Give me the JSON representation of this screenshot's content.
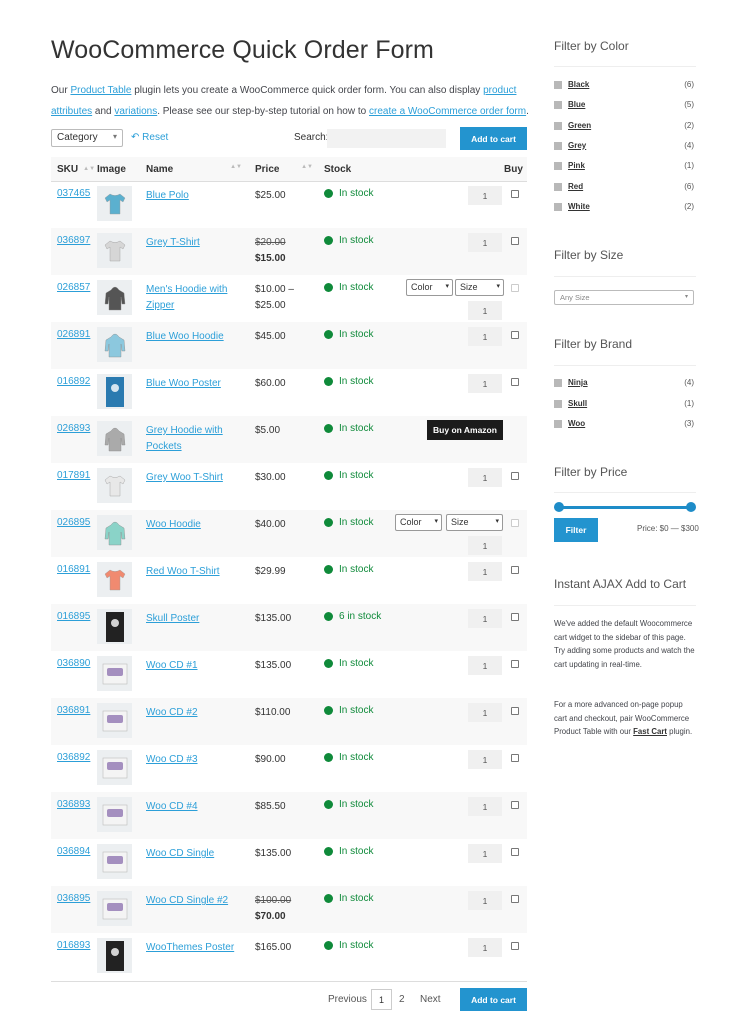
{
  "title": "WooCommerce Quick Order Form",
  "intro": {
    "t1": "Our ",
    "l1": "Product Table",
    "t2": " plugin lets you create a WooCommerce quick order form. You can also display ",
    "l2": "product attributes",
    "t3": " and ",
    "l3": "variations",
    "t4": ". Please see our step-by-step tutorial on how to ",
    "l4": "create a WooCommerce order form",
    "t5": "."
  },
  "controls": {
    "category": "Category",
    "reset": "Reset",
    "search_label": "Search:",
    "add_to_cart": "Add to cart"
  },
  "headers": {
    "sku": "SKU",
    "image": "Image",
    "name": "Name",
    "price": "Price",
    "stock": "Stock",
    "buy": "Buy"
  },
  "rows": [
    {
      "sku": "037465",
      "name": "Blue Polo",
      "price": "$25.00",
      "stock": "In stock",
      "qty": "1",
      "img": "tshirt",
      "color": "#5bb0cf"
    },
    {
      "sku": "036897",
      "name": "Grey T-Shirt",
      "price_old": "$20.00",
      "price": "$15.00",
      "stock": "In stock",
      "qty": "1",
      "img": "tshirt",
      "color": "#d6d6d6"
    },
    {
      "sku": "026857",
      "name": "Men's Hoodie with Zipper",
      "price": "$10.00 – $25.00",
      "stock": "In stock",
      "qty": "1",
      "img": "hoodie",
      "color": "#555",
      "variation": true
    },
    {
      "sku": "026891",
      "name": "Blue Woo Hoodie",
      "price": "$45.00",
      "stock": "In stock",
      "qty": "1",
      "img": "hoodie",
      "color": "#8cc8de"
    },
    {
      "sku": "016892",
      "name": "Blue Woo Poster",
      "price": "$60.00",
      "stock": "In stock",
      "qty": "1",
      "img": "poster",
      "color": "#2a7ab0"
    },
    {
      "sku": "026893",
      "name": "Grey Hoodie with Pockets",
      "price": "$5.00",
      "stock": "In stock",
      "amazon": "Buy on Amazon",
      "img": "hoodie",
      "color": "#aaa"
    },
    {
      "sku": "017891",
      "name": "Grey Woo T-Shirt",
      "price": "$30.00",
      "stock": "In stock",
      "qty": "1",
      "img": "tshirt",
      "color": "#e8e8e8"
    },
    {
      "sku": "026895",
      "name": "Woo Hoodie",
      "price": "$40.00",
      "stock": "In stock",
      "qty": "1",
      "img": "hoodie",
      "color": "#8ad3c8",
      "variation": true
    },
    {
      "sku": "016891",
      "name": "Red Woo T-Shirt",
      "price": "$29.99",
      "stock": "In stock",
      "qty": "1",
      "img": "tshirt",
      "color": "#f08a70"
    },
    {
      "sku": "016895",
      "name": "Skull Poster",
      "price": "$135.00",
      "stock": "6 in stock",
      "qty": "1",
      "img": "poster",
      "color": "#222"
    },
    {
      "sku": "036890",
      "name": "Woo CD #1",
      "price": "$135.00",
      "stock": "In stock",
      "qty": "1",
      "img": "cd",
      "color": "#a48fbf"
    },
    {
      "sku": "036891",
      "name": "Woo CD #2",
      "price": "$110.00",
      "stock": "In stock",
      "qty": "1",
      "img": "cd",
      "color": "#a48fbf"
    },
    {
      "sku": "036892",
      "name": "Woo CD #3",
      "price": "$90.00",
      "stock": "In stock",
      "qty": "1",
      "img": "cd",
      "color": "#a48fbf"
    },
    {
      "sku": "036893",
      "name": "Woo CD #4",
      "price": "$85.50",
      "stock": "In stock",
      "qty": "1",
      "img": "cd",
      "color": "#a48fbf"
    },
    {
      "sku": "036894",
      "name": "Woo CD Single",
      "price": "$135.00",
      "stock": "In stock",
      "qty": "1",
      "img": "cd",
      "color": "#a48fbf"
    },
    {
      "sku": "036895",
      "name": "Woo CD Single #2",
      "price_old": "$100.00",
      "price": "$70.00",
      "stock": "In stock",
      "qty": "1",
      "img": "cd",
      "color": "#a48fbf"
    },
    {
      "sku": "016893",
      "name": "WooThemes Poster",
      "price": "$165.00",
      "stock": "In stock",
      "qty": "1",
      "img": "poster",
      "color": "#222"
    }
  ],
  "variation_labels": {
    "color": "Color",
    "size": "Size"
  },
  "pagination": {
    "previous": "Previous",
    "p1": "1",
    "p2": "2",
    "next": "Next"
  },
  "sidebar": {
    "color_title": "Filter by Color",
    "colors": [
      {
        "label": "Black",
        "count": "(6)"
      },
      {
        "label": "Blue",
        "count": "(5)"
      },
      {
        "label": "Green",
        "count": "(2)"
      },
      {
        "label": "Grey",
        "count": "(4)"
      },
      {
        "label": "Pink",
        "count": "(1)"
      },
      {
        "label": "Red",
        "count": "(6)"
      },
      {
        "label": "White",
        "count": "(2)"
      }
    ],
    "size_title": "Filter by Size",
    "size_placeholder": "Any Size",
    "brand_title": "Filter by Brand",
    "brands": [
      {
        "label": "Ninja",
        "count": "(4)"
      },
      {
        "label": "Skull",
        "count": "(1)"
      },
      {
        "label": "Woo",
        "count": "(3)"
      }
    ],
    "price_title": "Filter by Price",
    "filter_button": "Filter",
    "price_range": "Price: $0 — $300",
    "ajax_title": "Instant AJAX Add to Cart",
    "ajax_p1": "We've added the default Woocommerce cart widget to the sidebar of this page. Try adding some products and watch the cart updating in real-time.",
    "ajax_p2a": "For a more advanced on-page popup cart and checkout, pair WooCommerce Product Table with our ",
    "ajax_link": "Fast Cart",
    "ajax_p2b": " plugin."
  }
}
